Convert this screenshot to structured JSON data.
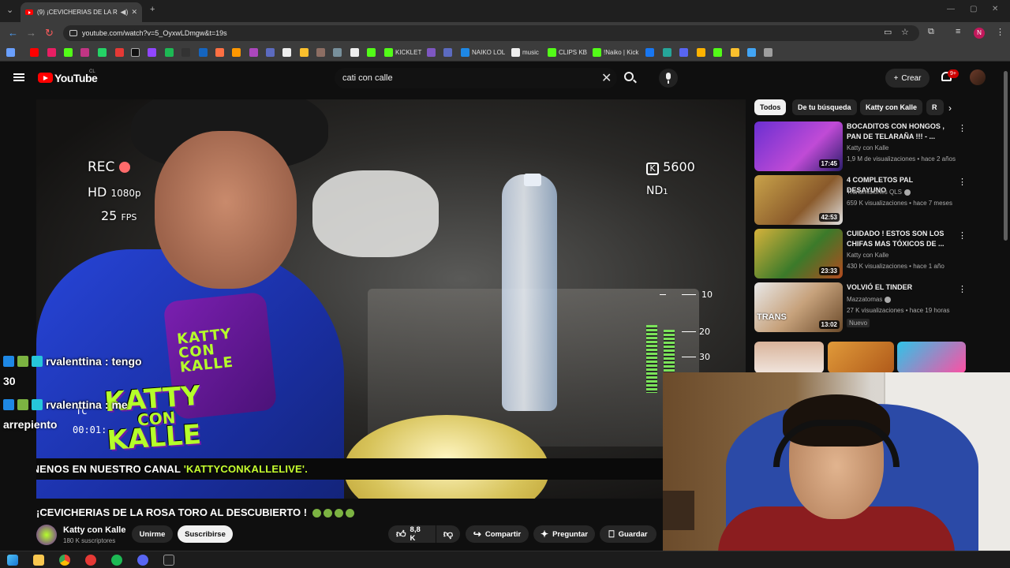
{
  "browser": {
    "tab_title": "(9) ¡CEVICHERIAS DE LA RO",
    "url": "youtube.com/watch?v=5_OyxwLDmgw&t=19s",
    "profile_initial": "N",
    "bookmarks": [
      {
        "label": "KICKLET",
        "color": "#53fc18"
      },
      {
        "label": "NAIKO LOL",
        "color": "#1e88e5"
      },
      {
        "label": "music",
        "color": "#eeeeee"
      },
      {
        "label": "CLIPS KB",
        "color": "#53fc18"
      },
      {
        "label": "!Naiko | Kick",
        "color": "#53fc18"
      }
    ]
  },
  "youtube": {
    "logo_text": "YouTube",
    "country_code": "CL",
    "search_query": "cati con calle",
    "create_label": "Crear",
    "notifications_badge": "9+"
  },
  "player": {
    "rec_label": "REC",
    "hd_label": "HD",
    "resolution": "1080p",
    "fps_value": "25",
    "fps_label": "FPS",
    "kelvin": "5600",
    "nd_label": "ND",
    "nd_value": "1",
    "meter_scale": [
      "10",
      "20",
      "30"
    ],
    "timecode_label": "TC",
    "timecode": "00:01:",
    "ticker_prefix": "ÚNENOS EN NUESTRO CANAL ",
    "ticker_highlight": "'KATTYCONKALLELIVE'.",
    "mic_cube_text": "KATTY CON KALLE",
    "logo_line1": "KATTY",
    "logo_line2": "CON",
    "logo_line3": "KALLE"
  },
  "chat": [
    {
      "user": "rvalenttina",
      "text": "tengo",
      "cont": "30"
    },
    {
      "user": "rvalenttina",
      "text": "me",
      "cont": "arrepiento"
    }
  ],
  "video": {
    "title": "¡CEVICHERIAS DE LA ROSA TORO AL DESCUBIERTO !",
    "channel": "Katty con Kalle",
    "subscribers": "180 K suscriptores",
    "join_label": "Unirme",
    "subscribe_label": "Suscribirse",
    "likes": "8,8 K",
    "share_label": "Compartir",
    "ask_label": "Preguntar",
    "save_label": "Guardar"
  },
  "chips": [
    "Todos",
    "De tu búsqueda",
    "Katty con Kalle",
    "R"
  ],
  "recommendations": [
    {
      "title": "BOCADITOS CON HONGOS , PAN DE TELARAÑA !!! - ...",
      "channel": "Katty con Kalle",
      "views": "1,9 M de visualizaciones",
      "age": "hace 2 años",
      "duration": "17:45",
      "verified": false,
      "new": false,
      "thumb": "linear-gradient(135deg,#6a2fd1,#c04bd6 60%,#2a1d6b)"
    },
    {
      "title": "4 COMPLETOS PAL DESAYUNO",
      "channel": "Transmisiones QLS",
      "views": "659 K visualizaciones",
      "age": "hace 7 meses",
      "duration": "42:53",
      "verified": true,
      "new": false,
      "thumb": "linear-gradient(135deg,#c9a34a,#8a5a2b 60%,#e1e1e1)"
    },
    {
      "title": "CUIDADO ! ESTOS SON LOS CHIFAS MAS TÓXICOS DE ...",
      "channel": "Katty con Kalle",
      "views": "430 K visualizaciones",
      "age": "hace 1 año",
      "duration": "23:33",
      "verified": false,
      "new": false,
      "thumb": "linear-gradient(135deg,#d6b23b,#3b7a2a 55%,#b24a1e)"
    },
    {
      "title": "VOLVIÓ EL TINDER",
      "channel": "Mazzatomas",
      "views": "27 K visualizaciones",
      "age": "hace 19 horas",
      "duration": "13:02",
      "verified": true,
      "new": true,
      "new_label": "Nuevo",
      "thumb_text": "TRANS",
      "thumb": "linear-gradient(135deg,#e8e8e8,#c7a27c 50%,#6a4a2a)"
    }
  ],
  "colors": {
    "accent": "#ff0000",
    "channel_green": "#b5ff2a",
    "background": "#0f0f0f"
  }
}
